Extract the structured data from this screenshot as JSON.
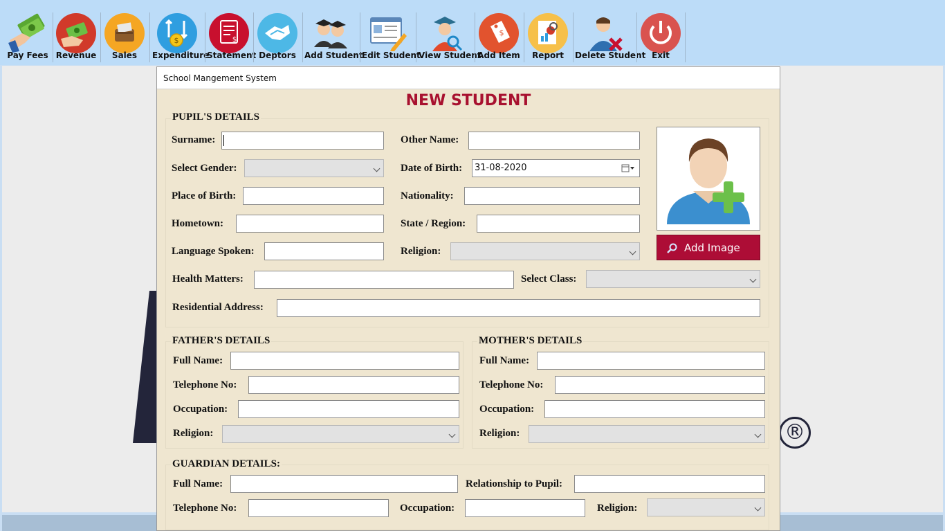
{
  "toolbar": {
    "items": [
      {
        "label": "Pay Fees",
        "icon": "pay-fees-icon"
      },
      {
        "label": "Revenue",
        "icon": "revenue-icon"
      },
      {
        "label": "Sales",
        "icon": "sales-icon"
      },
      {
        "label": "Expenditure",
        "icon": "expenditure-icon"
      },
      {
        "label": "Statement",
        "icon": "statement-icon"
      },
      {
        "label": "Deptors",
        "icon": "deptors-icon"
      },
      {
        "label": "Add Student",
        "icon": "add-student-icon"
      },
      {
        "label": "Edit Student",
        "icon": "edit-student-icon"
      },
      {
        "label": "View Student",
        "icon": "view-student-icon"
      },
      {
        "label": "Add Item",
        "icon": "add-item-icon"
      },
      {
        "label": "Report",
        "icon": "report-icon"
      },
      {
        "label": "Delete Student",
        "icon": "delete-student-icon"
      },
      {
        "label": "Exit",
        "icon": "exit-icon"
      }
    ]
  },
  "desktop": {
    "registered_mark": "®"
  },
  "dialog": {
    "title": "School Mangement System",
    "heading": "NEW STUDENT",
    "add_image_label": "Add Image",
    "pupil": {
      "title": "PUPIL'S  DETAILS",
      "surname": "Surname:",
      "other_name": "Other Name:",
      "gender": "Select Gender:",
      "dob": "Date of Birth:",
      "dob_value": "31-08-2020",
      "place_of_birth": "Place of Birth:",
      "nationality": "Nationality:",
      "hometown": "Hometown:",
      "state_region": "State / Region:",
      "language": "Language Spoken:",
      "religion": "Religion:",
      "health": "Health Matters:",
      "class": "Select Class:",
      "address": "Residential Address:"
    },
    "father": {
      "title": "FATHER'S DETAILS",
      "full_name": "Full Name:",
      "telephone": "Telephone No:",
      "occupation": "Occupation:",
      "religion": "Religion:"
    },
    "mother": {
      "title": "MOTHER'S DETAILS",
      "full_name": "Full Name:",
      "telephone": "Telephone No:",
      "occupation": "Occupation:",
      "religion": "Religion:"
    },
    "guardian": {
      "title": "GUARDIAN DETAILS:",
      "full_name": "Full Name:",
      "relationship": "Relationship to Pupil:",
      "telephone": "Telephone No:",
      "occupation": "Occupation:",
      "religion": "Religion:"
    }
  },
  "colors": {
    "toolbar_bg": "#bcdcf8",
    "dialog_bg": "#efe6d0",
    "accent": "#a8112f"
  }
}
